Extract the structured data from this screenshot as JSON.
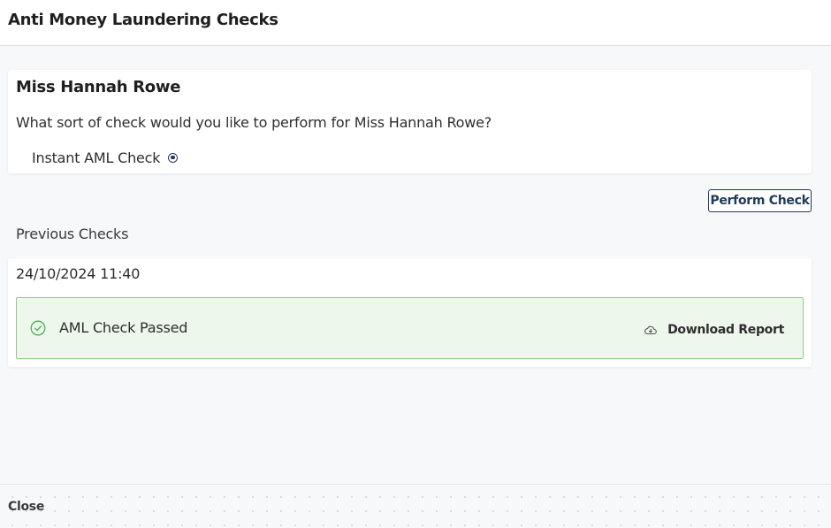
{
  "header": {
    "title": "Anti Money Laundering Checks"
  },
  "client": {
    "name": "Miss Hannah Rowe",
    "question": "What sort of check would you like to perform for Miss Hannah Rowe?",
    "options": [
      {
        "label": "Instant AML Check",
        "selected": true
      }
    ]
  },
  "actions": {
    "perform_label": "Perform Check"
  },
  "history": {
    "section_label": "Previous Checks",
    "checks": [
      {
        "date": "24/10/2024 11:40",
        "status": "AML Check Passed",
        "status_color": "#4caf50",
        "download_label": "Download Report"
      }
    ]
  },
  "footer": {
    "close_label": "Close"
  },
  "colors": {
    "accent": "#1f3a5c",
    "success_bg": "#eef7ec",
    "success_border": "#8fcc8a"
  }
}
